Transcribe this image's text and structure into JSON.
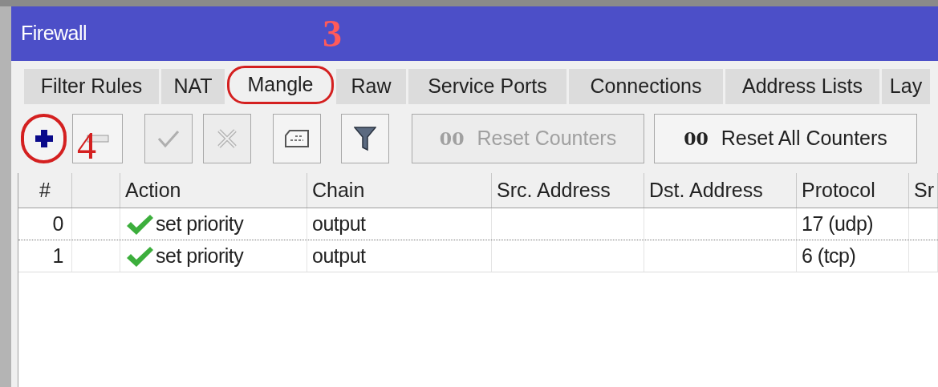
{
  "window": {
    "title": "Firewall"
  },
  "tabs": [
    {
      "label": "Filter Rules",
      "selected": false,
      "circled": false
    },
    {
      "label": "NAT",
      "selected": false,
      "circled": false
    },
    {
      "label": "Mangle",
      "selected": true,
      "circled": true
    },
    {
      "label": "Raw",
      "selected": false,
      "circled": false
    },
    {
      "label": "Service Ports",
      "selected": false,
      "circled": false
    },
    {
      "label": "Connections",
      "selected": false,
      "circled": false
    },
    {
      "label": "Address Lists",
      "selected": false,
      "circled": false
    },
    {
      "label": "Lay",
      "selected": false,
      "circled": false
    }
  ],
  "toolbar": [
    {
      "kind": "add",
      "disabled": false,
      "circled": true
    },
    {
      "kind": "remove",
      "disabled": false,
      "circled": false
    },
    {
      "kind": "enable",
      "disabled": true,
      "circled": false
    },
    {
      "kind": "disable",
      "disabled": true,
      "circled": false
    },
    {
      "kind": "comment",
      "disabled": false,
      "circled": false
    },
    {
      "kind": "filter",
      "disabled": false,
      "circled": false
    },
    {
      "kind": "reset",
      "icon_text": "00",
      "label": "Reset Counters",
      "disabled": true,
      "circled": false
    },
    {
      "kind": "reset",
      "icon_text": "00",
      "label": "Reset All Counters",
      "disabled": false,
      "circled": false
    }
  ],
  "table": {
    "columns": [
      "#",
      "",
      "Action",
      "Chain",
      "Src. Address",
      "Dst. Address",
      "Protocol",
      "Sr"
    ],
    "rows": [
      {
        "cells": [
          "0",
          "",
          "set priority",
          "output",
          "",
          "",
          "17 (udp)",
          ""
        ],
        "enabled": true
      },
      {
        "cells": [
          "1",
          "",
          "set priority",
          "output",
          "",
          "",
          "6 (tcp)",
          ""
        ],
        "enabled": true
      }
    ]
  },
  "annotations": [
    {
      "text": "3"
    },
    {
      "text": "4"
    }
  ]
}
